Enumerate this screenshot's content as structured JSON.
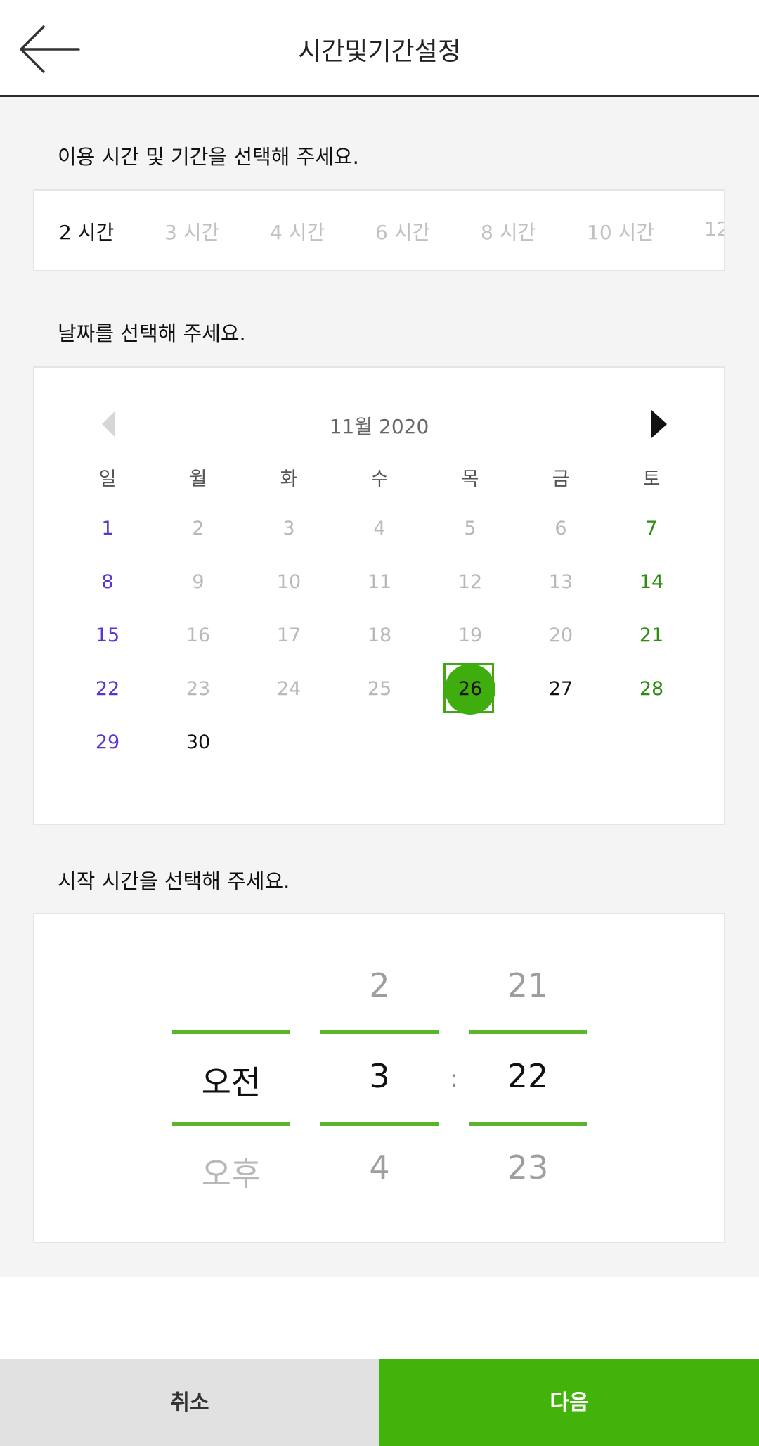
{
  "header": {
    "title": "시간및기간설정",
    "back_icon": "arrow-left-icon"
  },
  "duration": {
    "label": "이용 시간 및 기간을 선택해 주세요.",
    "options": [
      "2 시간",
      "3 시간",
      "4 시간",
      "6 시간",
      "8 시간",
      "10 시간",
      "12"
    ],
    "selected": "2 시간"
  },
  "calendar": {
    "label": "날짜를 선택해 주세요.",
    "month_title": "11월 2020",
    "weekdays": [
      "일",
      "월",
      "화",
      "수",
      "목",
      "금",
      "토"
    ],
    "weeks": [
      [
        "1",
        "2",
        "3",
        "4",
        "5",
        "6",
        "7"
      ],
      [
        "8",
        "9",
        "10",
        "11",
        "12",
        "13",
        "14"
      ],
      [
        "15",
        "16",
        "17",
        "18",
        "19",
        "20",
        "21"
      ],
      [
        "22",
        "23",
        "24",
        "25",
        "26",
        "27",
        "28"
      ],
      [
        "29",
        "30",
        "",
        "",
        "",
        "",
        ""
      ]
    ],
    "selected_day": "26",
    "available_days": [
      "26",
      "27",
      "28",
      "29",
      "30"
    ],
    "colors": {
      "sunday": "#5a35d0",
      "saturday": "#2e8b10",
      "disabled": "#b8b8b8",
      "selected_fill": "#3fad0e"
    }
  },
  "time": {
    "label": "시작 시간을 선택해 주세요.",
    "ampm": {
      "above": "",
      "selected": "오전",
      "below": "오후"
    },
    "hour": {
      "above": "2",
      "selected": "3",
      "below": "4"
    },
    "minute": {
      "above": "21",
      "selected": "22",
      "below": "23"
    },
    "separator": ":"
  },
  "footer": {
    "cancel_label": "취소",
    "next_label": "다음"
  },
  "colors": {
    "accent": "#42b30b",
    "line": "#5bb42c",
    "cancel_bg": "#e1e1e1"
  }
}
